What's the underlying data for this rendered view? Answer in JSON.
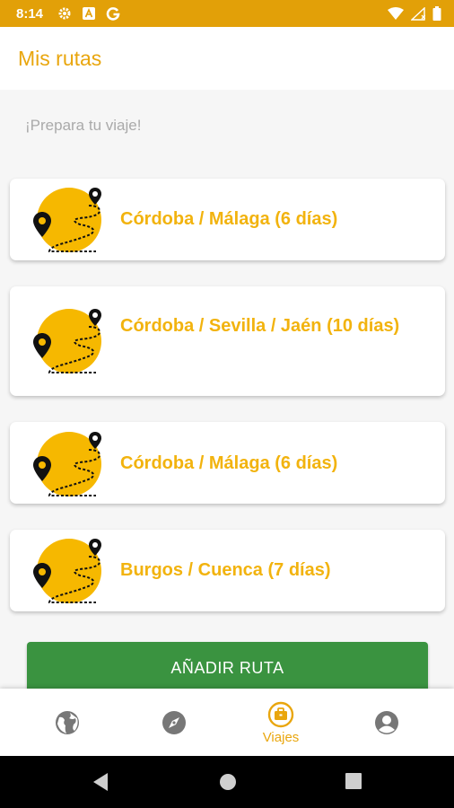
{
  "status_bar": {
    "time": "8:14",
    "icons": [
      "settings-icon",
      "a-icon",
      "g-icon",
      "wifi-icon",
      "signal-icon",
      "battery-icon"
    ]
  },
  "app_bar": {
    "title": "Mis rutas"
  },
  "subtitle": "¡Prepara tu viaje!",
  "routes": [
    {
      "label": "Córdoba / Málaga (6 días)"
    },
    {
      "label": "Córdoba / Sevilla / Jaén (10 días)"
    },
    {
      "label": "Córdoba / Málaga (6 días)"
    },
    {
      "label": "Burgos / Cuenca (7 días)"
    }
  ],
  "add_button": {
    "label": "AÑADIR RUTA"
  },
  "bottom_nav": {
    "items": [
      {
        "icon": "globe-icon",
        "label": ""
      },
      {
        "icon": "compass-icon",
        "label": ""
      },
      {
        "icon": "briefcase-icon",
        "label": "Viajes",
        "active": true
      },
      {
        "icon": "account-icon",
        "label": ""
      }
    ]
  },
  "colors": {
    "primary": "#E2A008",
    "accent_text": "#F2B30E",
    "button": "#3A9340",
    "nav_inactive": "#777777"
  }
}
